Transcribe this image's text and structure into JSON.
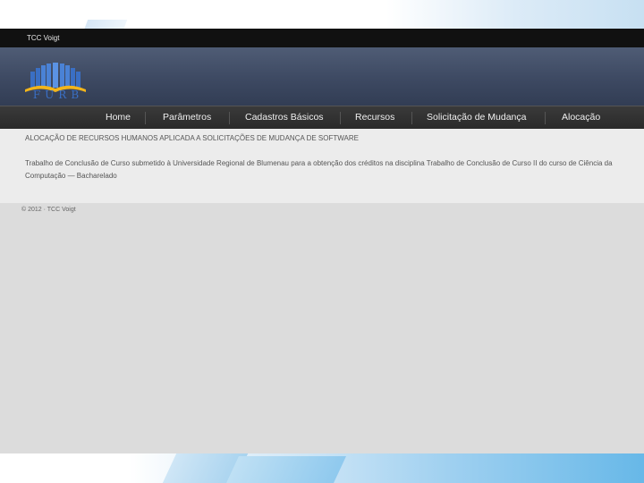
{
  "app": {
    "title": "TCC Voigt",
    "logo_text": "FURB"
  },
  "nav": {
    "items": [
      {
        "label": "Home"
      },
      {
        "label": "Parâmetros"
      },
      {
        "label": "Cadastros Básicos"
      },
      {
        "label": "Recursos"
      },
      {
        "label": "Solicitação de Mudança"
      },
      {
        "label": "Alocação"
      }
    ]
  },
  "content": {
    "title": "ALOCAÇÃO DE RECURSOS HUMANOS APLICADA A SOLICITAÇÕES DE MUDANÇA DE SOFTWARE",
    "description": "Trabalho de Conclusão de Curso submetido à Universidade Regional de Blumenau para a obtenção dos créditos na disciplina Trabalho de Conclusão de Curso II do curso de Ciência da Computação — Bacharelado"
  },
  "footer": {
    "copyright": "© 2012 · TCC Voigt"
  },
  "colors": {
    "topbar": "#111111",
    "header": "#3d4962",
    "navbar": "#2a2a2a",
    "content_bg": "#ececec",
    "page_bg": "#dcdcdc",
    "logo_blue": "#3a6fc4",
    "logo_yellow": "#f2b51b"
  },
  "icons": {
    "logo": "furb-book-logo"
  }
}
